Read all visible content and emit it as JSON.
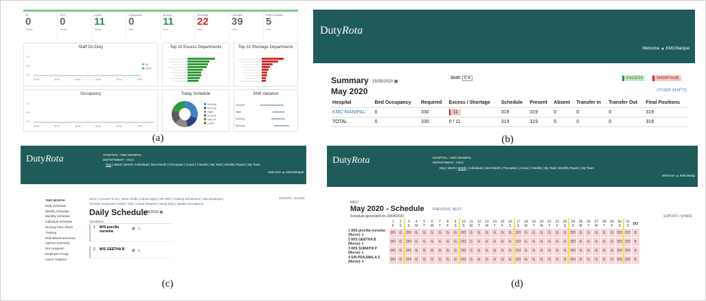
{
  "captions": [
    "(a)",
    "(b)",
    "(c)",
    "(d)"
  ],
  "a": {
    "stats": [
      {
        "label": "IN",
        "value": "0",
        "sub": "Today",
        "color": "#666"
      },
      {
        "label": "OUT",
        "value": "0",
        "sub": "Today",
        "color": "#666"
      },
      {
        "label": "Leave",
        "value": "11",
        "sub": "Today",
        "color": "#2e8b57"
      },
      {
        "label": "Occupancy",
        "value": "0",
        "sub": "Now",
        "color": "#666"
      },
      {
        "label": "Excess",
        "value": "11",
        "sub": "Now",
        "color": "#2e8b57"
      },
      {
        "label": "Shortage",
        "value": "22",
        "sub": "Now",
        "color": "#d22"
      },
      {
        "label": "Changes",
        "value": "39",
        "sub": "Now",
        "color": "#666"
      },
      {
        "label": "Shift Changes",
        "value": "5",
        "sub": "Now",
        "color": "#666"
      }
    ],
    "staff_title": "Staff On Duty",
    "excess_title": "Top 10 Excess Departments",
    "shortage_title": "Top 10 Shortage Departments",
    "occupancy_title": "Occupancy",
    "today_title": "Today Schedule",
    "variance_title": "Shift Variance",
    "legend_in": "IN",
    "legend_out": "OUT",
    "time_ticks": [
      "2PM",
      "3PM",
      "4PM",
      "5PM",
      "6PM",
      "7PM"
    ],
    "pie_legend": [
      "Morning",
      "Evening",
      "Night",
      "General",
      "Day Off",
      "Leave"
    ],
    "variance_rows": [
      "General",
      "Night",
      "Evening",
      "Morning"
    ]
  },
  "b": {
    "logo_main": "Duty",
    "logo_italic": "Rota",
    "welcome": "Welcome",
    "user": "KMCManipal",
    "summary": "Summary",
    "date": "15/05/2020",
    "shift_label": "Shift:",
    "shift_value": "E",
    "excess": "EXCESS",
    "shortage": "SHORTAGE",
    "month": "May 2020",
    "other_shifts": "OTHER SHIFTS",
    "headers": [
      "Hospital",
      "Bed Occupancy",
      "Required",
      "Excess / Shortage",
      "Schedule",
      "Present",
      "Absent",
      "Transfer In",
      "Transfer Out",
      "Final Positions"
    ],
    "rows": [
      [
        "KMC-MANIPAL",
        "0",
        "330",
        "11",
        "319",
        "319",
        "0",
        "0",
        "0",
        "319"
      ],
      [
        "TOTAL",
        "0",
        "330",
        "0 / 11",
        "319",
        "319",
        "0",
        "0",
        "0",
        "319"
      ]
    ]
  },
  "c": {
    "logo_main": "Duty",
    "logo_italic": "Rota",
    "hospital_line": "HOSPITAL : KMC-MANIPAL",
    "department_line": "DEPARTMENT : HICC",
    "nav": [
      "Day",
      "Week",
      "Month",
      "Individual",
      "Next Month",
      "Preceptee",
      "Actual",
      "Transfer",
      "My Task",
      "Monthly Report",
      "My Team"
    ],
    "welcome": "Welcome",
    "user": "KMCManipal",
    "sidebar": [
      "THIS MONTH",
      "Daily Schedule",
      "Weekly Schedule",
      "Monthly Schedule",
      "Individual Schedule",
      "Nursing Face Sheet",
      "Training",
      "Role Based Summary",
      "Agency Summary",
      "Not Assigned",
      "Employee Group",
      "Leave Analytics"
    ],
    "links_line1": "HICC | Convert To EL | Other Shifts | Adjust Night | OR Shift | Training Enrollment | Add Employee |",
    "links_line2": "Transfer Employee | Admin Task | Leave Request | Swap Duty | Update Occupancy",
    "export": "EXPORT",
    "share": "SHARE",
    "title": "Daily Schedule",
    "date": "15/05/2020",
    "general": "GENERAL",
    "entries": [
      {
        "num": "1",
        "name": "W/S precilla noronha"
      },
      {
        "num": "2",
        "name": "W/S GEETHA B"
      }
    ]
  },
  "d": {
    "logo_main": "Duty",
    "logo_italic": "Rota",
    "hospital_line": "HOSPITAL : KMC-MANIPAL",
    "department_line": "DEPARTMENT : HICC",
    "nav": [
      "Day",
      "Week",
      "Month",
      "Individual",
      "Next Month",
      "Preceptee",
      "Actual",
      "Transfer",
      "My Task",
      "Monthly Report",
      "My Team"
    ],
    "welcome": "Welcome",
    "user": "KMCManip",
    "dept": "HICC",
    "title": "May 2020 - Schedule",
    "previous": "PREVIOUS",
    "next": "NEXT",
    "generated": "Schedule generated on 29/04/2020",
    "export": "EXPORT",
    "share": "SHARE",
    "days": [
      "1",
      "2",
      "3",
      "4",
      "5",
      "6",
      "7",
      "8",
      "9",
      "10",
      "11",
      "12",
      "13",
      "14",
      "15",
      "16",
      "17",
      "18",
      "19",
      "20",
      "21",
      "22",
      "23",
      "24",
      "25",
      "26",
      "27",
      "28",
      "29",
      "30",
      "31"
    ],
    "dows": [
      "F",
      "S",
      "S",
      "M",
      "T",
      "W",
      "T",
      "F",
      "S",
      "S",
      "M",
      "T",
      "W",
      "T",
      "F",
      "S",
      "S",
      "M",
      "T",
      "W",
      "T",
      "F",
      "S",
      "S",
      "M",
      "T",
      "W",
      "T",
      "F",
      "S",
      "S"
    ],
    "last_col": "DO",
    "staff": [
      {
        "name": "1 W/S precilla noronha (Nurse)",
        "cells": [
          "DO",
          "G",
          "DO",
          "G",
          "G",
          "G",
          "G",
          "G",
          "G",
          "DO",
          "G",
          "G",
          "G",
          "G",
          "G",
          "G",
          "DO",
          "G",
          "G",
          "G",
          "G",
          "G",
          "G",
          "DO",
          "G",
          "G",
          "G",
          "G",
          "G",
          "DO",
          "DO"
        ],
        "end": "8"
      },
      {
        "name": "2 W/S GEETHA B (Nurse)",
        "cells": [
          "DO",
          "G",
          "DO",
          "G",
          "G",
          "G",
          "G",
          "G",
          "G",
          "DO",
          "G",
          "G",
          "G",
          "G",
          "G",
          "G",
          "DO",
          "G",
          "G",
          "G",
          "G",
          "G",
          "G",
          "DO",
          "G",
          "G",
          "G",
          "G",
          "G",
          "DO",
          "DO"
        ],
        "end": "8"
      },
      {
        "name": "3 W/S SUMATHI P (Nurse)",
        "cells": [
          "DO",
          "G",
          "DO",
          "G",
          "G",
          "G",
          "G",
          "G",
          "G",
          "DO",
          "G",
          "G",
          "G",
          "G",
          "G",
          "G",
          "DO",
          "G",
          "G",
          "G",
          "G",
          "G",
          "G",
          "DO",
          "G",
          "G",
          "G",
          "G",
          "G",
          "DO",
          "DO"
        ],
        "end": "8"
      },
      {
        "name": "4 S/N PRAJWALA S (Nurse)",
        "cells": [
          "DO",
          "G",
          "DO",
          "G",
          "G",
          "G",
          "G",
          "G",
          "G",
          "DO",
          "G",
          "G",
          "G",
          "G",
          "G",
          "G",
          "DO",
          "G",
          "G",
          "G",
          "G",
          "G",
          "G",
          "DO",
          "G",
          "G",
          "G",
          "G",
          "G",
          "DO",
          "DO"
        ],
        "end": "8"
      }
    ]
  }
}
